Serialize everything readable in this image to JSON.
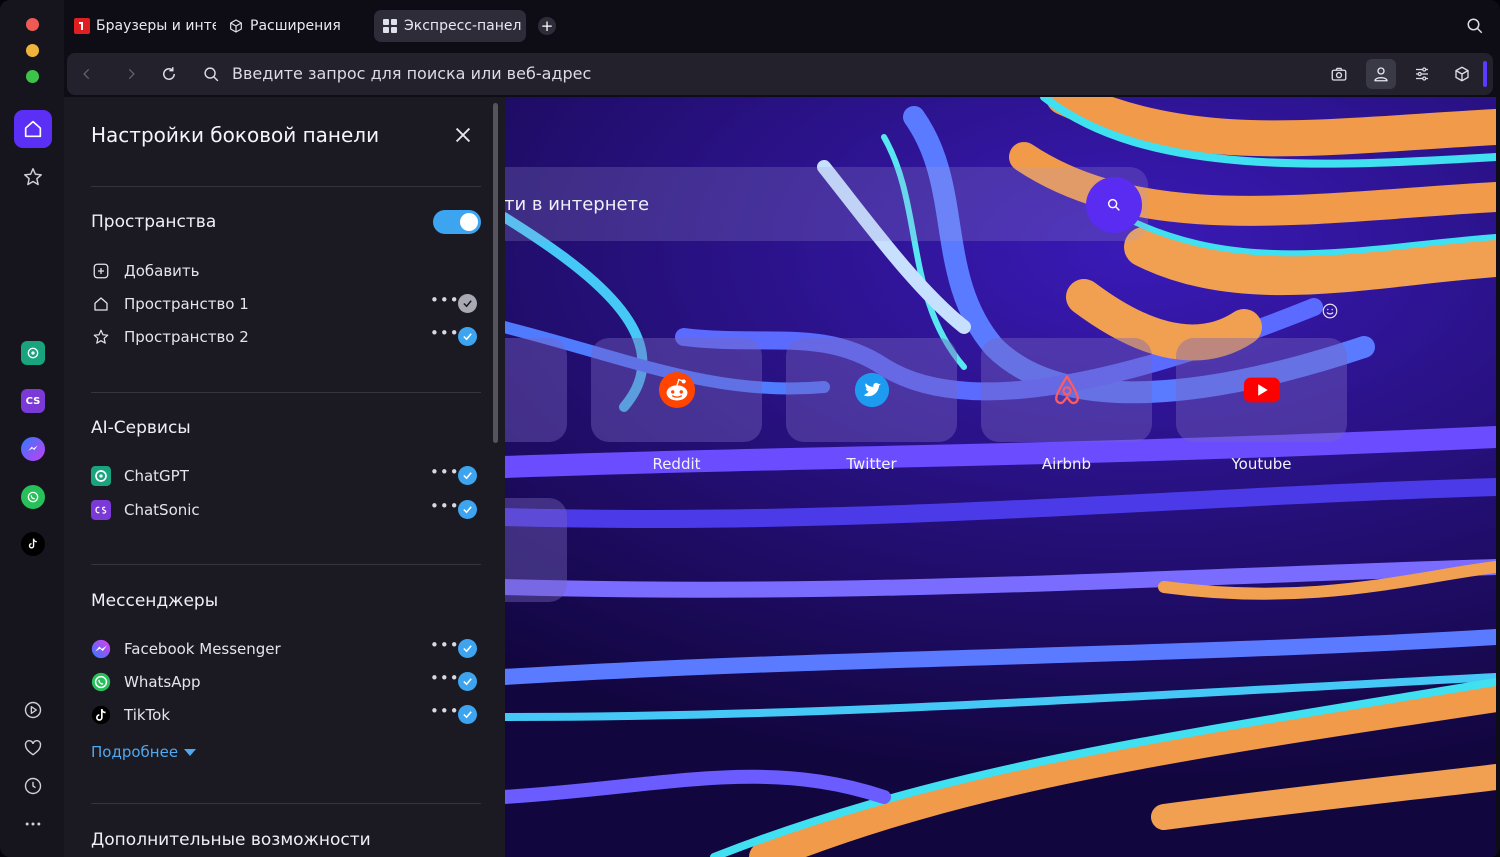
{
  "tabs": [
    {
      "label": "Браузеры и инте",
      "icon": "opera-logo-icon"
    },
    {
      "label": "Расширения",
      "icon": "cube-icon"
    },
    {
      "label": "Экспресс-панел",
      "icon": "grid-icon",
      "active": true
    }
  ],
  "address": {
    "placeholder": "Введите запрос для поиска или веб-адрес"
  },
  "search": {
    "placeholder": "ти в интернете"
  },
  "speed_dial": [
    {
      "label": "Reddit",
      "icon": "reddit-icon"
    },
    {
      "label": "Twitter",
      "icon": "twitter-icon"
    },
    {
      "label": "Airbnb",
      "icon": "airbnb-icon"
    },
    {
      "label": "Youtube",
      "icon": "youtube-icon"
    }
  ],
  "panel": {
    "title": "Настройки боковой панели",
    "spaces": {
      "title": "Пространства",
      "toggle_on": true,
      "add_label": "Добавить",
      "items": [
        {
          "label": "Пространство 1",
          "icon": "home-icon",
          "checked": true
        },
        {
          "label": "Пространство 2",
          "icon": "star-icon",
          "checked": true
        }
      ]
    },
    "ai": {
      "title": "AI-Сервисы",
      "items": [
        {
          "label": "ChatGPT",
          "icon": "chatgpt-icon",
          "checked": true
        },
        {
          "label": "ChatSonic",
          "icon": "chatsonic-icon",
          "checked": true
        }
      ]
    },
    "messengers": {
      "title": "Мессенджеры",
      "items": [
        {
          "label": "Facebook Messenger",
          "icon": "messenger-icon",
          "checked": true
        },
        {
          "label": "WhatsApp",
          "icon": "whatsapp-icon",
          "checked": true
        },
        {
          "label": "TikTok",
          "icon": "tiktok-icon",
          "checked": true
        }
      ],
      "more_label": "Подробнее"
    },
    "extra": {
      "title": "Дополнительные возможности"
    }
  },
  "sidebar_apps": {
    "chatsonic_text": "CS"
  },
  "colors": {
    "accent": "#5b2ff5",
    "check": "#3da4f0",
    "link": "#4fa8f0"
  }
}
